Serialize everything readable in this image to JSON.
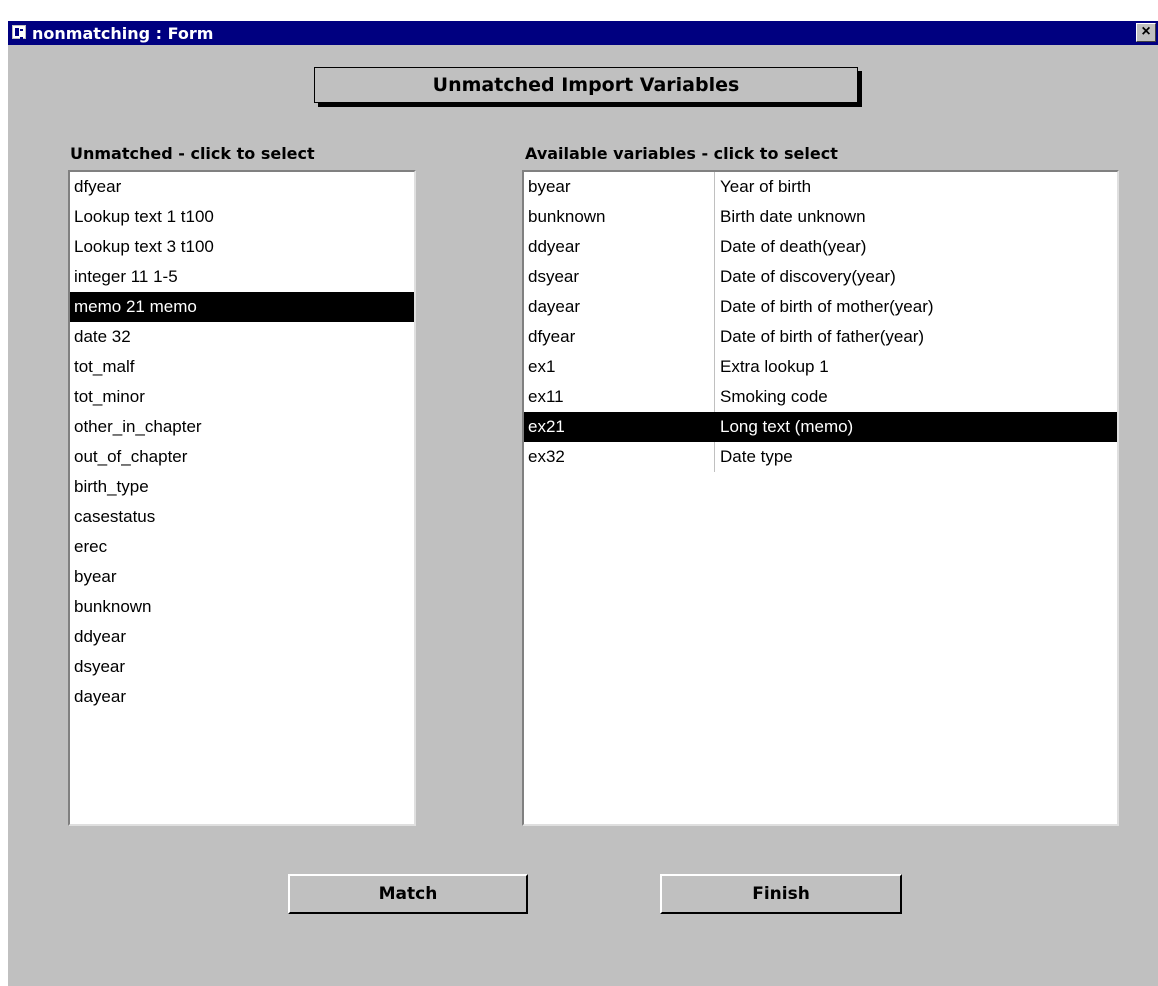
{
  "window": {
    "title": "nonmatching : Form",
    "close_glyph": "×",
    "icon": "form-icon"
  },
  "header": {
    "title": "Unmatched Import Variables"
  },
  "unmatched": {
    "label": "Unmatched - click to select",
    "selected_index": 4,
    "items": [
      "dfyear",
      "Lookup text 1 t100",
      "Lookup text 3 t100",
      "integer 11 1-5",
      "memo 21 memo",
      "date 32",
      "tot_malf",
      "tot_minor",
      "other_in_chapter",
      "out_of_chapter",
      "birth_type",
      "casestatus",
      "erec",
      "byear",
      "bunknown",
      "ddyear",
      "dsyear",
      "dayear"
    ]
  },
  "available": {
    "label": "Available variables - click to select",
    "selected_index": 8,
    "rows": [
      {
        "name": "byear",
        "desc": "Year of birth"
      },
      {
        "name": "bunknown",
        "desc": "Birth date unknown"
      },
      {
        "name": "ddyear",
        "desc": "Date of death(year)"
      },
      {
        "name": "dsyear",
        "desc": "Date of discovery(year)"
      },
      {
        "name": "dayear",
        "desc": "Date of birth of mother(year)"
      },
      {
        "name": "dfyear",
        "desc": "Date of birth of father(year)"
      },
      {
        "name": "ex1",
        "desc": "Extra lookup 1"
      },
      {
        "name": "ex11",
        "desc": "Smoking code"
      },
      {
        "name": "ex21",
        "desc": "Long text (memo)"
      },
      {
        "name": "ex32",
        "desc": "Date type"
      }
    ]
  },
  "buttons": {
    "match": "Match",
    "finish": "Finish"
  },
  "colors": {
    "titlebar": "#000080",
    "face": "#c0c0c0",
    "selection": "#000000"
  }
}
